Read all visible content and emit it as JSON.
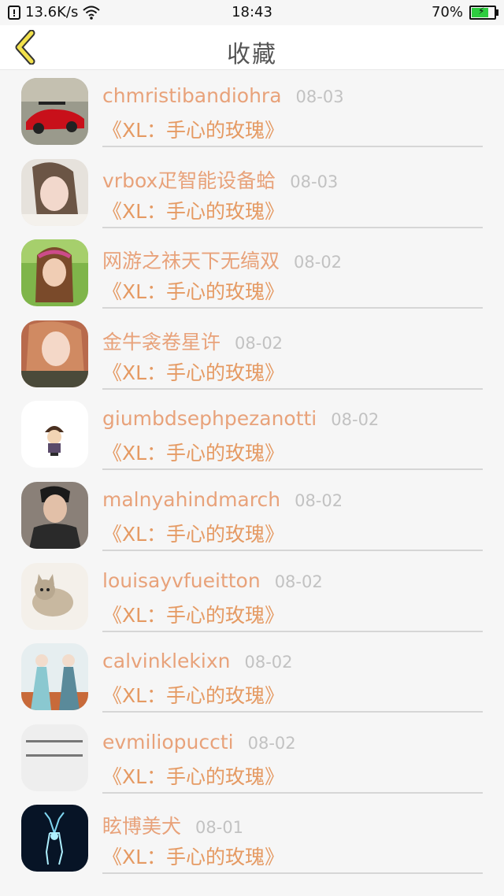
{
  "status_bar": {
    "speed": "13.6K/s",
    "time": "18:43",
    "battery": "70%"
  },
  "header": {
    "title": "收藏"
  },
  "items": [
    {
      "name": "chmristibandiohra",
      "date": "08-03",
      "song": "《XL：手心的玫瑰》",
      "avatar": "car-avatar"
    },
    {
      "name": "vrbox疋智能设备蛤",
      "date": "08-03",
      "song": "《XL：手心的玫瑰》",
      "avatar": "girl-avatar"
    },
    {
      "name": "网游之祙天下无缟双",
      "date": "08-02",
      "song": "《XL：手心的玫瑰》",
      "avatar": "child-avatar"
    },
    {
      "name": "金牛衾卷星许",
      "date": "08-02",
      "song": "《XL：手心的玫瑰》",
      "avatar": "girl-selfie-avatar"
    },
    {
      "name": "giumbdsephpezanotti",
      "date": "08-02",
      "song": "《XL：手心的玫瑰》",
      "avatar": "cartoon-avatar"
    },
    {
      "name": "malnyahindmarch",
      "date": "08-02",
      "song": "《XL：手心的玫瑰》",
      "avatar": "man-avatar"
    },
    {
      "name": "louisayvfueitton",
      "date": "08-02",
      "song": "《XL：手心的玫瑰》",
      "avatar": "cat-avatar"
    },
    {
      "name": "calvinklekixn",
      "date": "08-02",
      "song": "《XL：手心的玫瑰》",
      "avatar": "anime-couple-avatar"
    },
    {
      "name": "evmiliopuccti",
      "date": "08-02",
      "song": "《XL：手心的玫瑰》",
      "avatar": "text-avatar"
    },
    {
      "name": "眩博美犬",
      "date": "08-01",
      "song": "《XL：手心的玫瑰》",
      "avatar": "deer-avatar"
    }
  ]
}
